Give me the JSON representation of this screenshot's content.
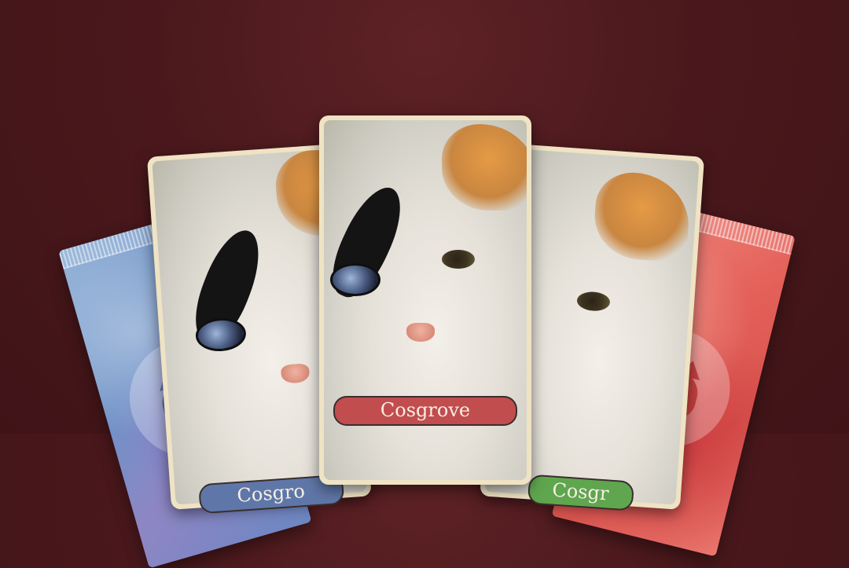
{
  "cards": {
    "center": {
      "name": "Cosgrove",
      "banner_color": "#c24d4f"
    },
    "left": {
      "name": "Cosgro",
      "banner_color": "#5f77a8"
    },
    "right": {
      "name": "Cosgr",
      "banner_color": "#5fa64f"
    }
  },
  "packs": {
    "left": {
      "color": "#6f92c7"
    },
    "right": {
      "color": "#e4625a"
    }
  }
}
